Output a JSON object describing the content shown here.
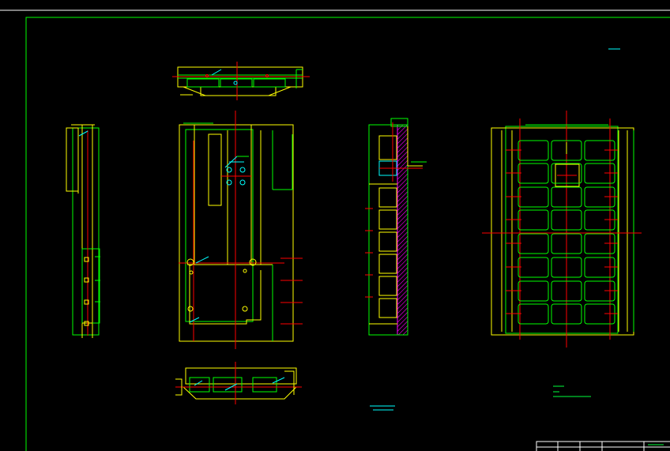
{
  "drawing": {
    "background": "#000000",
    "colors": {
      "frame": "#ffffff",
      "border": "#00ff00",
      "outline": "#ffff00",
      "centerline": "#ff0000",
      "detail": "#00ffff",
      "hatch": "#ff00ff",
      "annotation": "#00ff3c"
    }
  },
  "annotations": {
    "top_right_label": "",
    "note_a_line1": "",
    "note_a_line2": "",
    "note_b_title": "",
    "note_b_line1": "",
    "note_b_line2": "",
    "title_block_text": ""
  }
}
